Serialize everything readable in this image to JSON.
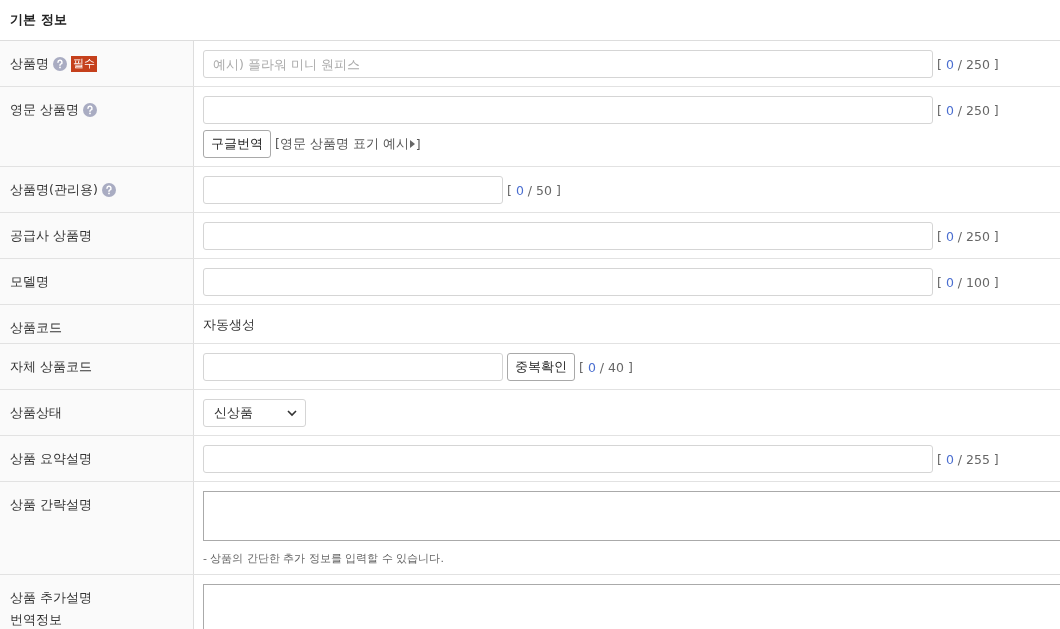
{
  "section": {
    "title": "기본 정보"
  },
  "rows": [
    {
      "label": "상품명",
      "help": true,
      "required_badge": "필수",
      "kind": "long_text",
      "placeholder": "예시) 플라워 미니 원피스",
      "counter": {
        "open": "[",
        "count": "0",
        "rest": "/ 250 ]"
      }
    },
    {
      "label": "영문 상품명",
      "help": true,
      "kind": "long_text",
      "counter": {
        "open": "[",
        "count": "0",
        "rest": "/ 250 ]"
      },
      "button": "구글번역",
      "link": {
        "text": "[영문 상품명 표기 예시",
        "close": "]"
      }
    },
    {
      "label": "상품명(관리용)",
      "help": true,
      "kind": "short_text",
      "counter": {
        "open": "[",
        "count": "0",
        "rest": "/ 50 ]"
      }
    },
    {
      "label": "공급사 상품명",
      "help": false,
      "kind": "long_text",
      "counter": {
        "open": "[",
        "count": "0",
        "rest": "/ 250 ]"
      }
    },
    {
      "label": "모델명",
      "help": false,
      "kind": "long_text",
      "counter": {
        "open": "[",
        "count": "0",
        "rest": "/ 100 ]"
      }
    },
    {
      "label": "상품코드",
      "help": false,
      "kind": "static",
      "value": "자동생성"
    },
    {
      "label": "자체 상품코드",
      "help": false,
      "kind": "short_text",
      "button": "중복확인",
      "counter": {
        "open": "[",
        "count": "0",
        "rest": "/ 40 ]"
      }
    },
    {
      "label": "상품상태",
      "help": false,
      "kind": "select",
      "value": "신상품"
    },
    {
      "label": "상품 요약설명",
      "help": false,
      "kind": "long_text",
      "counter": {
        "open": "[",
        "count": "0",
        "rest": "/ 255 ]"
      }
    },
    {
      "label": "상품 간략설명",
      "help": false,
      "kind": "textarea",
      "note": "- 상품의 간단한 추가 정보를 입력할 수 있습니다."
    },
    {
      "label": "상품 추가설명\n번역정보",
      "help": false,
      "kind": "textarea"
    }
  ]
}
